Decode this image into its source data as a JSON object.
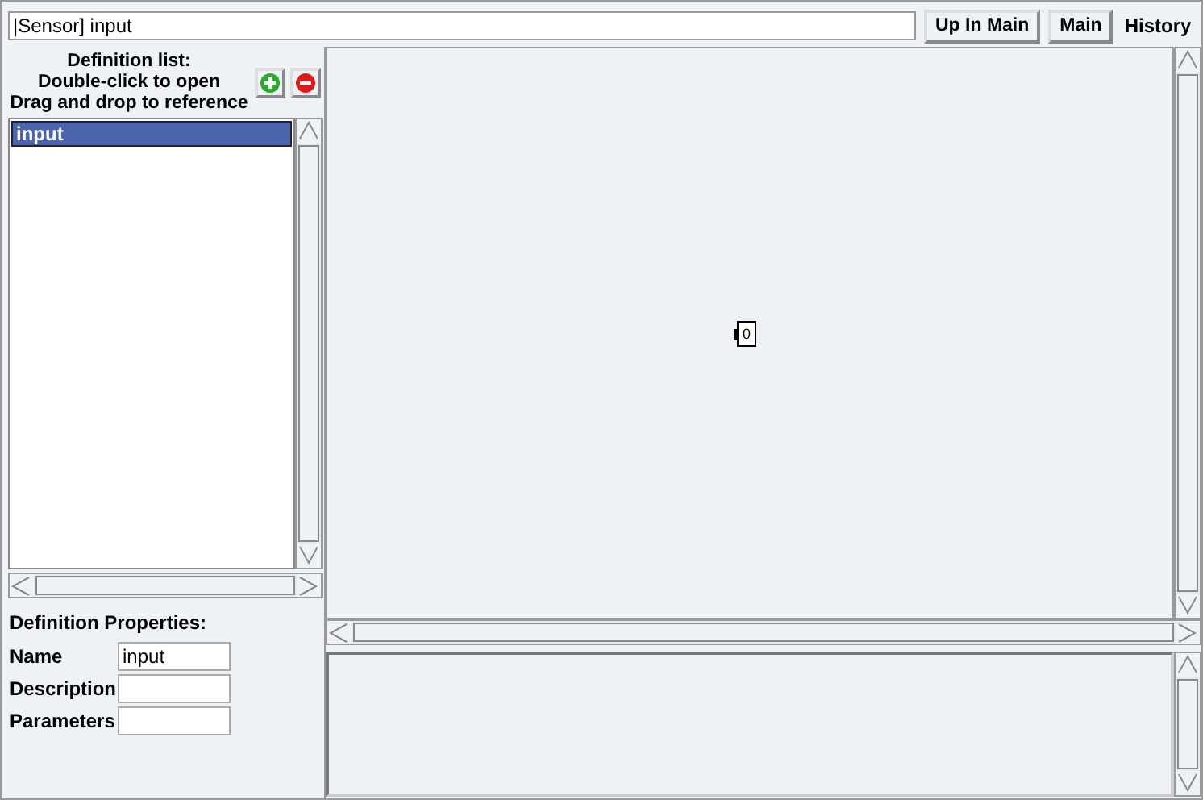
{
  "path_field": {
    "value": "|Sensor] input"
  },
  "buttons": [
    "Up In Main",
    "Main"
  ],
  "history_label": "History",
  "definition_list": {
    "header": [
      "Definition list:",
      "Double-click to open",
      "Drag and drop to reference"
    ],
    "items": [
      {
        "label": "input",
        "selected": true
      }
    ]
  },
  "properties": {
    "title": "Definition Properties:",
    "fields": [
      {
        "label": "Name",
        "value": "input"
      },
      {
        "label": "Description"
      },
      {
        "label": "Parameters"
      }
    ]
  },
  "canvas": {
    "nodes": [
      {
        "label": "0"
      }
    ]
  }
}
